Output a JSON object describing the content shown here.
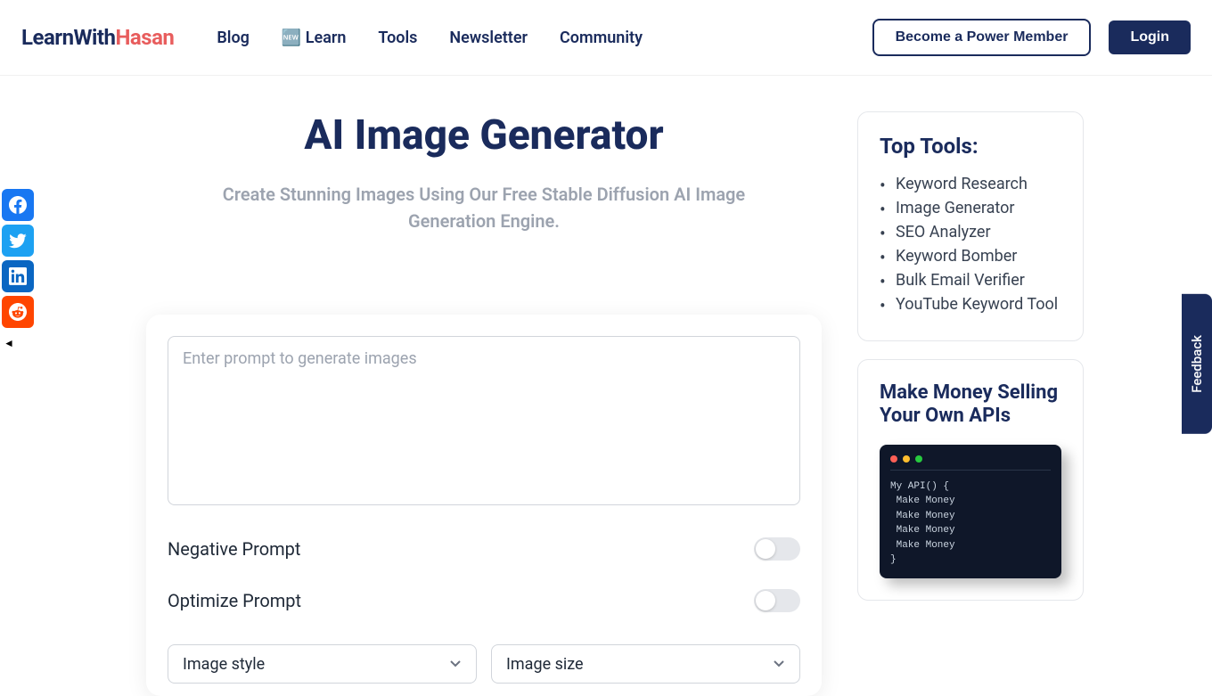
{
  "logo": {
    "part1": "LearnWith",
    "part2": "Hasan"
  },
  "nav": {
    "blog": "Blog",
    "learn": "🆕 Learn",
    "tools": "Tools",
    "newsletter": "Newsletter",
    "community": "Community"
  },
  "header_buttons": {
    "member": "Become a Power Member",
    "login": "Login"
  },
  "page": {
    "title": "AI Image Generator",
    "subtitle": "Create Stunning Images Using Our Free Stable Diffusion AI Image Generation Engine."
  },
  "form": {
    "prompt_placeholder": "Enter prompt to generate images",
    "negative_label": "Negative Prompt",
    "optimize_label": "Optimize Prompt",
    "style_select": "Image style",
    "size_select": "Image size"
  },
  "sidebar": {
    "top_tools_title": "Top Tools:",
    "tools": [
      "Keyword Research",
      "Image Generator",
      "SEO Analyzer",
      "Keyword Bomber",
      "Bulk Email Verifier",
      "YouTube Keyword Tool"
    ],
    "promo_title": "Make Money Selling Your Own APIs",
    "code_lines": "My API() {\n Make Money\n Make Money\n Make Money\n Make Money\n}"
  },
  "feedback": "Feedback"
}
